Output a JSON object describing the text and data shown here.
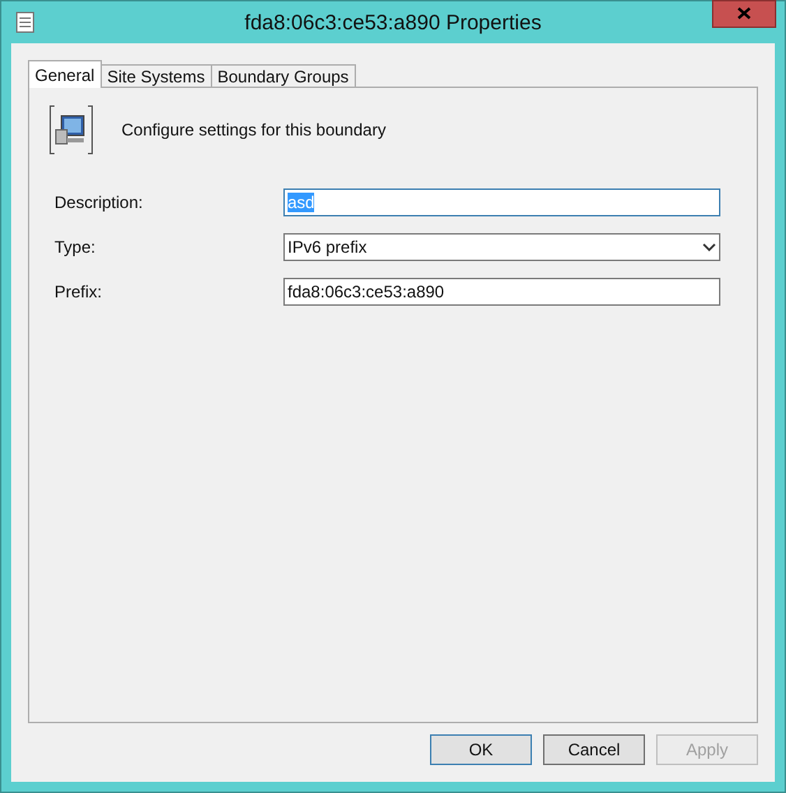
{
  "window": {
    "title": "fda8:06c3:ce53:a890 Properties"
  },
  "tabs": [
    {
      "label": "General",
      "selected": true
    },
    {
      "label": "Site Systems",
      "selected": false
    },
    {
      "label": "Boundary Groups",
      "selected": false
    }
  ],
  "header": {
    "text": "Configure settings for this boundary"
  },
  "fields": [
    {
      "label": "Description:",
      "kind": "text",
      "value": "asd",
      "focused": true,
      "text_selected": true
    },
    {
      "label": "Type:",
      "kind": "dropdown",
      "value": "IPv6 prefix",
      "focused": false,
      "text_selected": false
    },
    {
      "label": "Prefix:",
      "kind": "text",
      "value": "fda8:06c3:ce53:a890",
      "focused": false,
      "text_selected": false
    }
  ],
  "buttons": [
    {
      "label": "OK",
      "default": true,
      "disabled": false
    },
    {
      "label": "Cancel",
      "default": false,
      "disabled": false
    },
    {
      "label": "Apply",
      "default": false,
      "disabled": true
    }
  ]
}
